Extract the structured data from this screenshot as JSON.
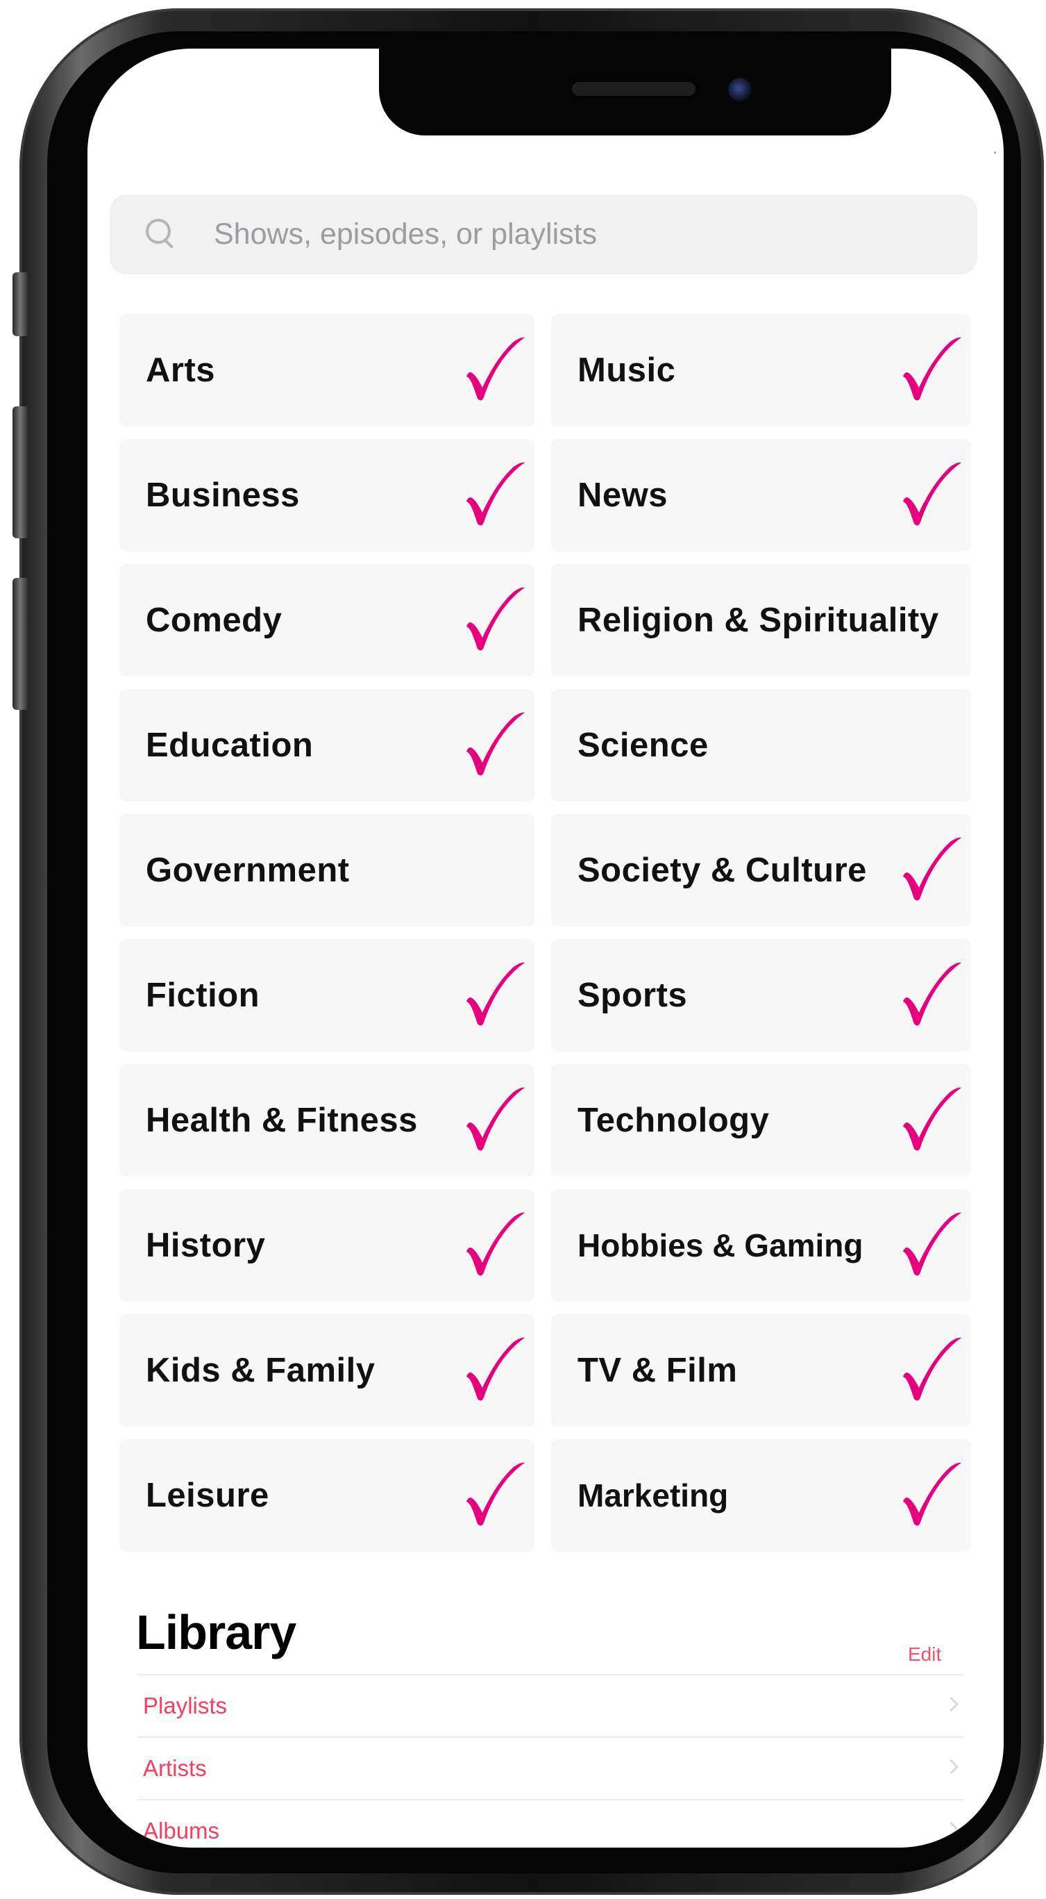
{
  "search": {
    "placeholder": "Shows, episodes, or playlists"
  },
  "colors": {
    "checkmark": "#e6007e",
    "library_accent": "#f43f5e"
  },
  "categories": [
    {
      "label": "Arts",
      "checked": true
    },
    {
      "label": "Music",
      "checked": true
    },
    {
      "label": "Business",
      "checked": true
    },
    {
      "label": "News",
      "checked": true
    },
    {
      "label": "Comedy",
      "checked": true
    },
    {
      "label": "Religion & Spirituality",
      "checked": false
    },
    {
      "label": "Education",
      "checked": true
    },
    {
      "label": "Science",
      "checked": false
    },
    {
      "label": "Government",
      "checked": false
    },
    {
      "label": "Society & Culture",
      "checked": true
    },
    {
      "label": "Fiction",
      "checked": true
    },
    {
      "label": "Sports",
      "checked": true
    },
    {
      "label": "Health & Fitness",
      "checked": true
    },
    {
      "label": "Technology",
      "checked": true
    },
    {
      "label": "History",
      "checked": true
    },
    {
      "label": "Hobbies  & Gaming",
      "checked": true
    },
    {
      "label": "Kids & Family",
      "checked": true
    },
    {
      "label": "TV & Film",
      "checked": true
    },
    {
      "label": "Leisure",
      "checked": true
    },
    {
      "label": "Marketing",
      "checked": true
    }
  ],
  "library": {
    "title": "Library",
    "edit_label": "Edit",
    "items": [
      {
        "label": "Playlists"
      },
      {
        "label": "Artists"
      },
      {
        "label": "Albums"
      }
    ]
  }
}
